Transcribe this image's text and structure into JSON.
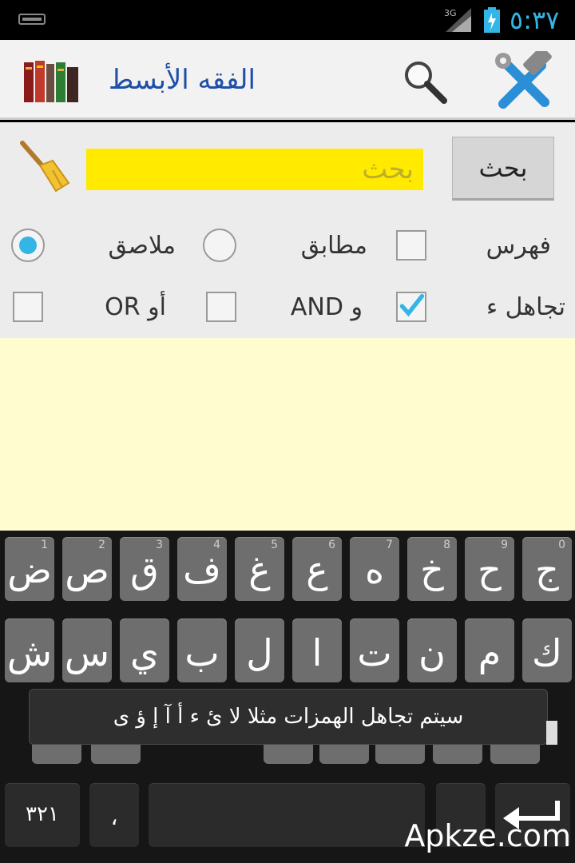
{
  "status_bar": {
    "time": "٥:٣٧",
    "network": "3G"
  },
  "action_bar": {
    "title": "الفقه الأبسط"
  },
  "search": {
    "placeholder": "بحث",
    "button_label": "بحث"
  },
  "options": {
    "row1": {
      "index_label": "فهرس",
      "exact_label": "مطابق",
      "adjacent_label": "ملاصق",
      "index_checked": false,
      "exact_selected": false,
      "adjacent_selected": true
    },
    "row2": {
      "ignore_label": "تجاهل ء",
      "and_label": "و AND",
      "or_label": "أو OR",
      "ignore_checked": true,
      "and_checked": false,
      "or_checked": false
    }
  },
  "keyboard": {
    "row1": [
      {
        "label": "ض",
        "num": "1"
      },
      {
        "label": "ص",
        "num": "2"
      },
      {
        "label": "ق",
        "num": "3"
      },
      {
        "label": "ف",
        "num": "4"
      },
      {
        "label": "غ",
        "num": "5"
      },
      {
        "label": "ع",
        "num": "6"
      },
      {
        "label": "ه",
        "num": "7"
      },
      {
        "label": "خ",
        "num": "8"
      },
      {
        "label": "ح",
        "num": "9"
      },
      {
        "label": "ج",
        "num": "0"
      }
    ],
    "row2": [
      "ش",
      "س",
      "ي",
      "ب",
      "ل",
      "ا",
      "ت",
      "ن",
      "م",
      "ك"
    ],
    "row4": {
      "numbers_key": "٣٢١",
      "comma_key": "،",
      "enter_icon": "enter-icon"
    }
  },
  "toast": {
    "text": "سيتم تجاهل الهمزات مثلا لا ئ ء أ آ إ ؤ ى"
  },
  "watermark": "Apkze.com",
  "colors": {
    "accent": "#33b5e5",
    "search_field": "#ffea00",
    "results_bg": "#fffcd0",
    "title": "#1f4fa8"
  }
}
